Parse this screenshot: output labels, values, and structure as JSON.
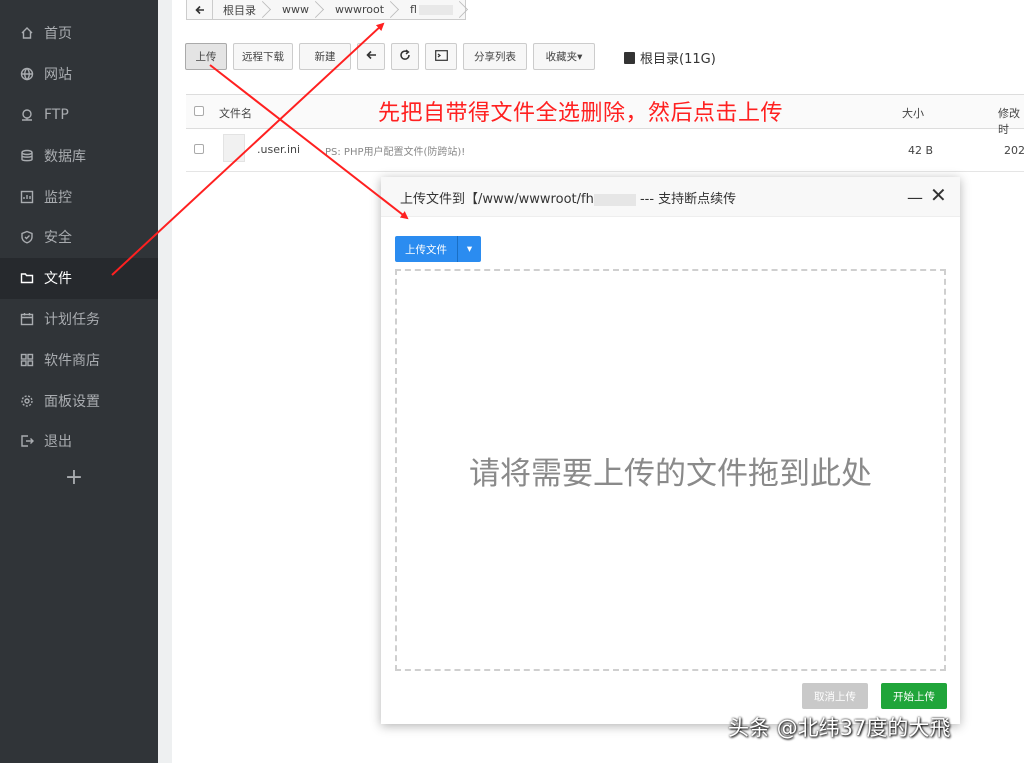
{
  "sidebar": {
    "items": [
      {
        "label": "首页",
        "icon": "home-icon"
      },
      {
        "label": "网站",
        "icon": "globe-icon"
      },
      {
        "label": "FTP",
        "icon": "ftp-icon"
      },
      {
        "label": "数据库",
        "icon": "database-icon"
      },
      {
        "label": "监控",
        "icon": "monitor-icon"
      },
      {
        "label": "安全",
        "icon": "shield-icon"
      },
      {
        "label": "文件",
        "icon": "folder-icon",
        "active": true
      },
      {
        "label": "计划任务",
        "icon": "calendar-icon"
      },
      {
        "label": "软件商店",
        "icon": "grid-icon"
      },
      {
        "label": "面板设置",
        "icon": "gear-icon"
      },
      {
        "label": "退出",
        "icon": "logout-icon"
      }
    ],
    "add_label": "+"
  },
  "breadcrumb": {
    "items": [
      "根目录",
      "www",
      "wwwroot",
      "fl"
    ]
  },
  "toolbar": {
    "upload": "上传",
    "remote_download": "远程下载",
    "new": "新建",
    "share_list": "分享列表",
    "favorites": "收藏夹▾",
    "disk": "根目录(11G)"
  },
  "table": {
    "headers": {
      "name": "文件名",
      "size": "大小",
      "modified": "修改时"
    },
    "rows": [
      {
        "name": ".user.ini",
        "note": "PS: PHP用户配置文件(防跨站)!",
        "size": "42 B",
        "modified": "202"
      }
    ]
  },
  "annotation": {
    "text": "先把自带得文件全选删除，然后点击上传",
    "color": "#ff2020"
  },
  "dialog": {
    "title_prefix": "上传文件到【/www/wwwroot/fh",
    "title_suffix": " --- 支持断点续传",
    "minimize": "—",
    "close": "✕",
    "upload_button": "上传文件",
    "upload_menu": "▾",
    "drop_text": "请将需要上传的文件拖到此处",
    "cancel_button": "取消上传",
    "start_button": "开始上传"
  },
  "watermark": "头条 @北纬37度的大飛",
  "colors": {
    "sidebar_bg": "#303438",
    "primary_blue": "#2b8cf0",
    "start_green": "#20a53a"
  }
}
